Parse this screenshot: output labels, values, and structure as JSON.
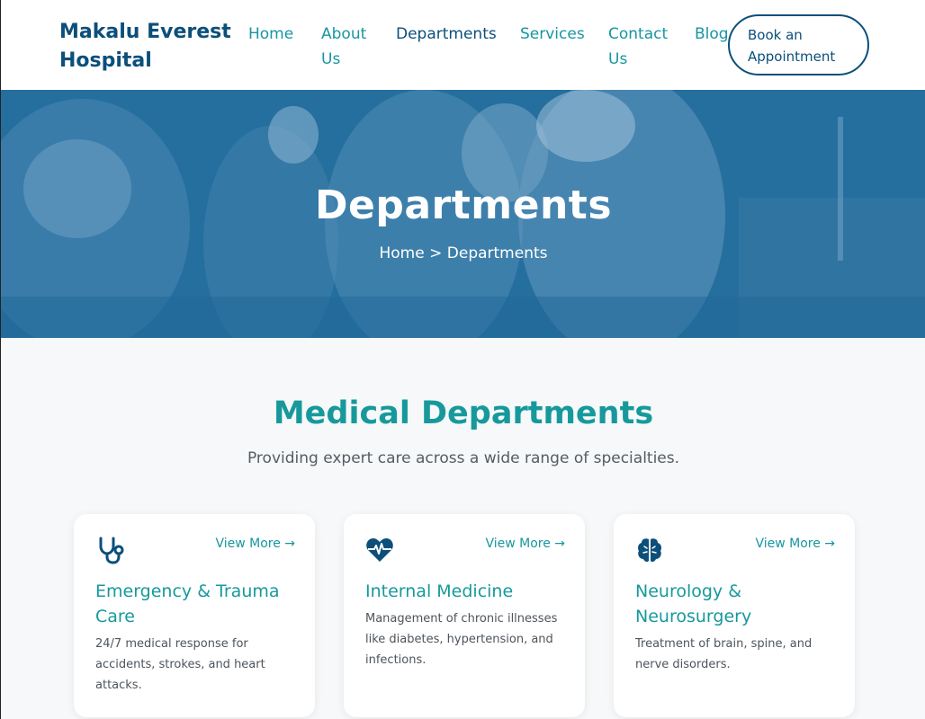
{
  "header": {
    "brand": "Makalu Everest Hospital",
    "nav": [
      {
        "label": "Home"
      },
      {
        "label": "About Us"
      },
      {
        "label": "Departments"
      },
      {
        "label": "Services"
      },
      {
        "label": "Contact Us"
      },
      {
        "label": "Blog"
      }
    ],
    "cta": "Book an Appointment"
  },
  "hero": {
    "title": "Departments",
    "breadcrumb": {
      "home": "Home",
      "sep": ">",
      "current": "Departments"
    }
  },
  "section": {
    "title": "Medical Departments",
    "subtitle": "Providing expert care across a wide range of specialties."
  },
  "cards": [
    {
      "icon": "stethoscope-icon",
      "view_more": "View More →",
      "title": "Emergency & Trauma Care",
      "desc": "24/7 medical response for accidents, strokes, and heart attacks."
    },
    {
      "icon": "heartbeat-icon",
      "view_more": "View More →",
      "title": "Internal Medicine",
      "desc": "Management of chronic illnesses like diabetes, hypertension, and infections."
    },
    {
      "icon": "brain-icon",
      "view_more": "View More →",
      "title": "Neurology & Neurosurgery",
      "desc": "Treatment of brain, spine, and nerve disorders."
    }
  ],
  "colors": {
    "brand": "#0b4f7a",
    "accent": "#17999c",
    "hero": "#1f6c9e"
  }
}
